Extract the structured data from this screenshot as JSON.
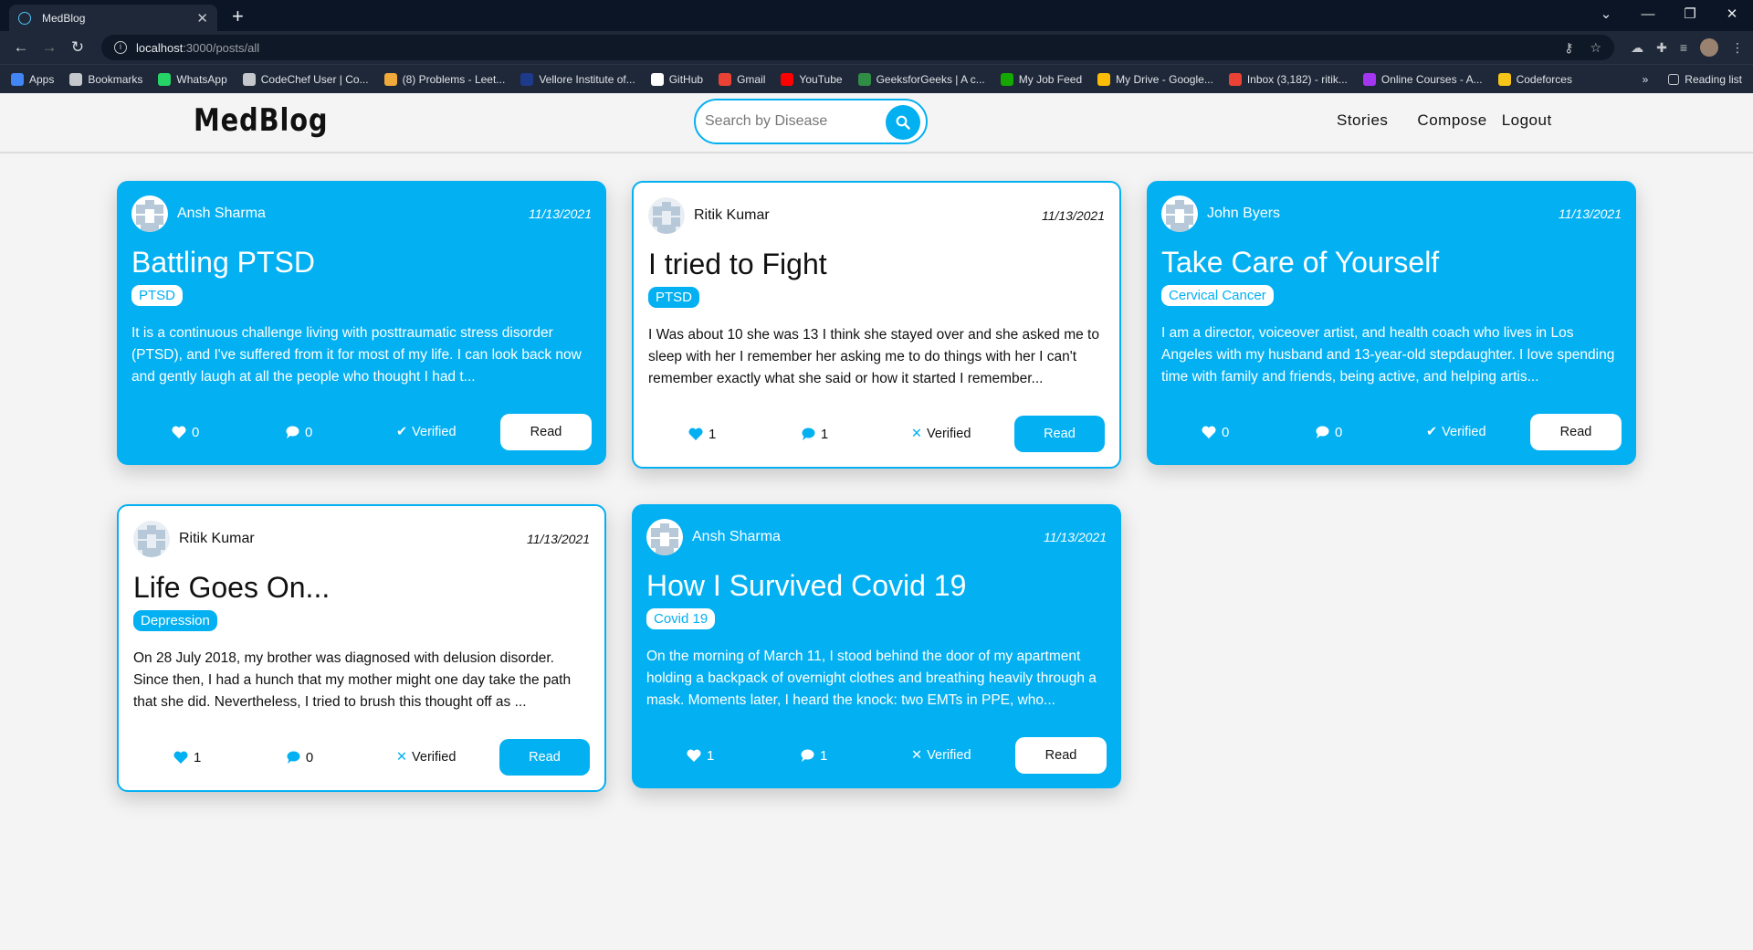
{
  "browser": {
    "tab_title": "MedBlog",
    "url_host": "localhost",
    "url_path": ":3000/posts/all",
    "bookmarks": [
      {
        "label": "Apps",
        "color": "#4285f4"
      },
      {
        "label": "Bookmarks",
        "color": "#c4c7cc"
      },
      {
        "label": "WhatsApp",
        "color": "#25d366"
      },
      {
        "label": "CodeChef User | Co...",
        "color": "#c4c7cc"
      },
      {
        "label": "(8) Problems - Leet...",
        "color": "#f0a93b"
      },
      {
        "label": "Vellore Institute of...",
        "color": "#1e3a8a"
      },
      {
        "label": "GitHub",
        "color": "#ffffff"
      },
      {
        "label": "Gmail",
        "color": "#ea4335"
      },
      {
        "label": "YouTube",
        "color": "#ff0000"
      },
      {
        "label": "GeeksforGeeks | A c...",
        "color": "#2f8d46"
      },
      {
        "label": "My Job Feed",
        "color": "#14a800"
      },
      {
        "label": "My Drive - Google...",
        "color": "#fbbc04"
      },
      {
        "label": "Inbox (3,182) - ritik...",
        "color": "#ea4335"
      },
      {
        "label": "Online Courses - A...",
        "color": "#a435f0"
      },
      {
        "label": "Codeforces",
        "color": "#f5c518"
      }
    ],
    "more": "»",
    "reading_list": "Reading list"
  },
  "nav": {
    "brand": "MedBlog",
    "search_placeholder": "Search by Disease",
    "links": [
      "Stories",
      "Compose",
      "Logout"
    ]
  },
  "colors": {
    "accent": "#03b0f2"
  },
  "posts": [
    {
      "author": "Ansh Sharma",
      "date": "11/13/2021",
      "title": "Battling PTSD",
      "tag": "PTSD",
      "excerpt": "It is a continuous challenge living with posttraumatic stress disorder (PTSD), and I've suffered from it for most of my life. I can look back now and gently laugh at all the people who thought I had t...",
      "likes": "0",
      "comments": "0",
      "verified": true,
      "verified_label": "Verified",
      "read": "Read",
      "style": "blue"
    },
    {
      "author": "Ritik Kumar",
      "date": "11/13/2021",
      "title": "I tried to Fight",
      "tag": "PTSD",
      "excerpt": "I Was about 10 she was 13 I think she stayed over and she asked me to sleep with her I remember her asking me to do things with her I can't remember exactly what she said or how it started I remember...",
      "likes": "1",
      "comments": "1",
      "verified": false,
      "verified_label": "Verified",
      "read": "Read",
      "style": "white"
    },
    {
      "author": "John Byers",
      "date": "11/13/2021",
      "title": "Take Care of Yourself",
      "tag": "Cervical Cancer",
      "excerpt": "I am a director, voiceover artist, and health coach who lives in Los Angeles with my husband and 13-year-old stepdaughter. I love spending time with family and friends, being active, and helping artis...",
      "likes": "0",
      "comments": "0",
      "verified": true,
      "verified_label": "Verified",
      "read": "Read",
      "style": "blue"
    },
    {
      "author": "Ritik Kumar",
      "date": "11/13/2021",
      "title": "Life Goes On...",
      "tag": "Depression",
      "excerpt": "On 28 July 2018, my brother was diagnosed with delusion disorder. Since then, I had a hunch that my mother might one day take the path that she did. Nevertheless, I tried to brush this thought off as ...",
      "likes": "1",
      "comments": "0",
      "verified": false,
      "verified_label": "Verified",
      "read": "Read",
      "style": "white"
    },
    {
      "author": "Ansh Sharma",
      "date": "11/13/2021",
      "title": "How I Survived Covid 19",
      "tag": "Covid 19",
      "excerpt": "On the morning of March 11, I stood behind the door of my apartment holding a backpack of overnight clothes and breathing heavily through a mask. Moments later, I heard the knock: two EMTs in PPE, who...",
      "likes": "1",
      "comments": "1",
      "verified": false,
      "verified_label": "Verified",
      "read": "Read",
      "style": "blue"
    }
  ]
}
